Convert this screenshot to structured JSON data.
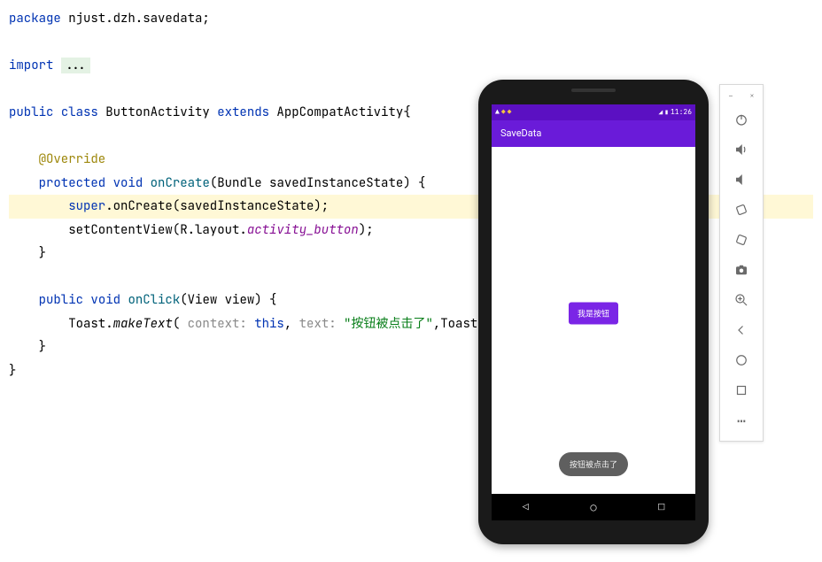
{
  "code": {
    "package_kw": "package",
    "package_name": " njust.dzh.savedata;",
    "import_kw": "import",
    "import_fold": "...",
    "public_kw": "public",
    "class_kw": "class",
    "class_name": " ButtonActivity ",
    "extends_kw": "extends",
    "super_class": " AppCompatActivity{",
    "annotation": "@Override",
    "protected_kw": "protected",
    "void_kw": "void",
    "onCreate": "onCreate",
    "onCreate_params": "(Bundle savedInstanceState) {",
    "super_kw": "super",
    "super_call": ".onCreate(savedInstanceState);",
    "setContent": "setContentView(R.layout.",
    "layout_ref": "activity_button",
    "setContent_end": ");",
    "brace_close": "}",
    "onClick": "onClick",
    "onClick_params": "(View view) {",
    "toast_class": "Toast.",
    "makeText": "makeText",
    "hint_context": " context: ",
    "this_kw": "this",
    "comma1": ", ",
    "hint_text": "text: ",
    "toast_str": "\"按钮被点击了\"",
    "toast_tail": ",Toast.L"
  },
  "emulator": {
    "status_time": "11:26",
    "app_title": "SaveData",
    "button_label": "我是按钮",
    "toast_text": "按钮被点击了"
  },
  "toolbar_icons": {
    "minimize": "–",
    "close": "×",
    "more": "⋯"
  }
}
